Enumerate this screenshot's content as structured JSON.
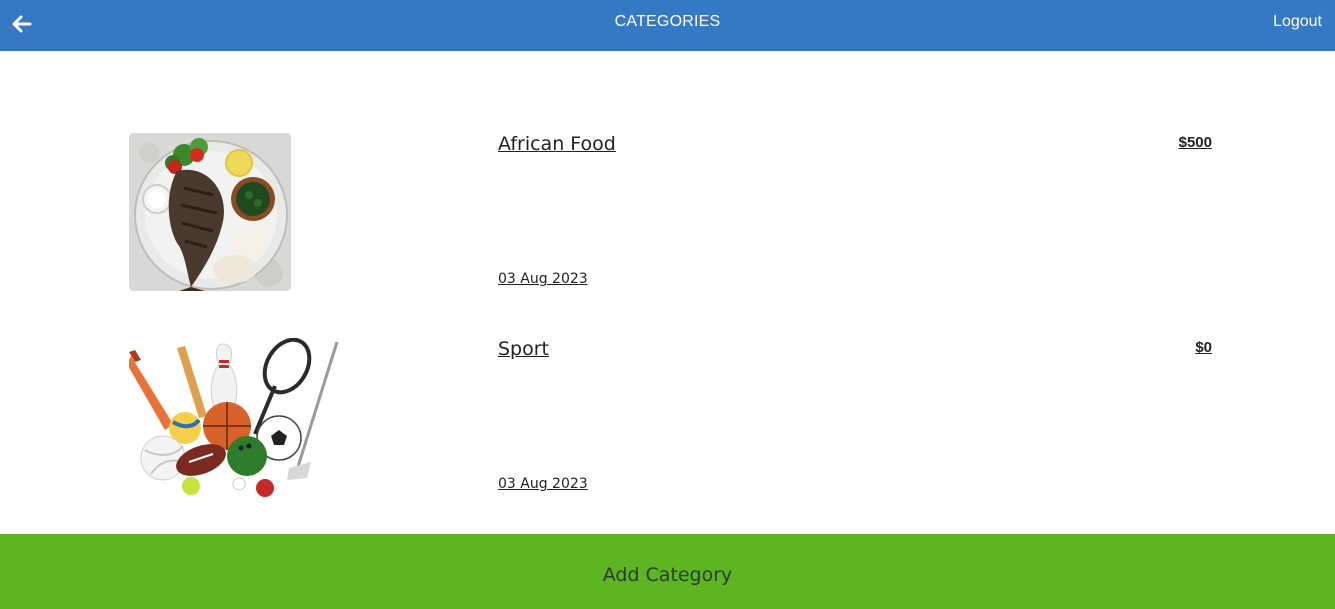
{
  "header": {
    "title": "CATEGORIES",
    "logout_label": "Logout",
    "back_icon": "arrow-left-icon",
    "background": "#3578c4"
  },
  "categories": [
    {
      "name": "African Food",
      "amount": "$500",
      "date": "03 Aug 2023",
      "image": "grilled-fish-plate-image"
    },
    {
      "name": "Sport",
      "amount": "$0",
      "date": "03 Aug 2023",
      "image": "sports-equipment-image"
    }
  ],
  "footer": {
    "add_label": "Add Category",
    "background": "#5db521"
  }
}
